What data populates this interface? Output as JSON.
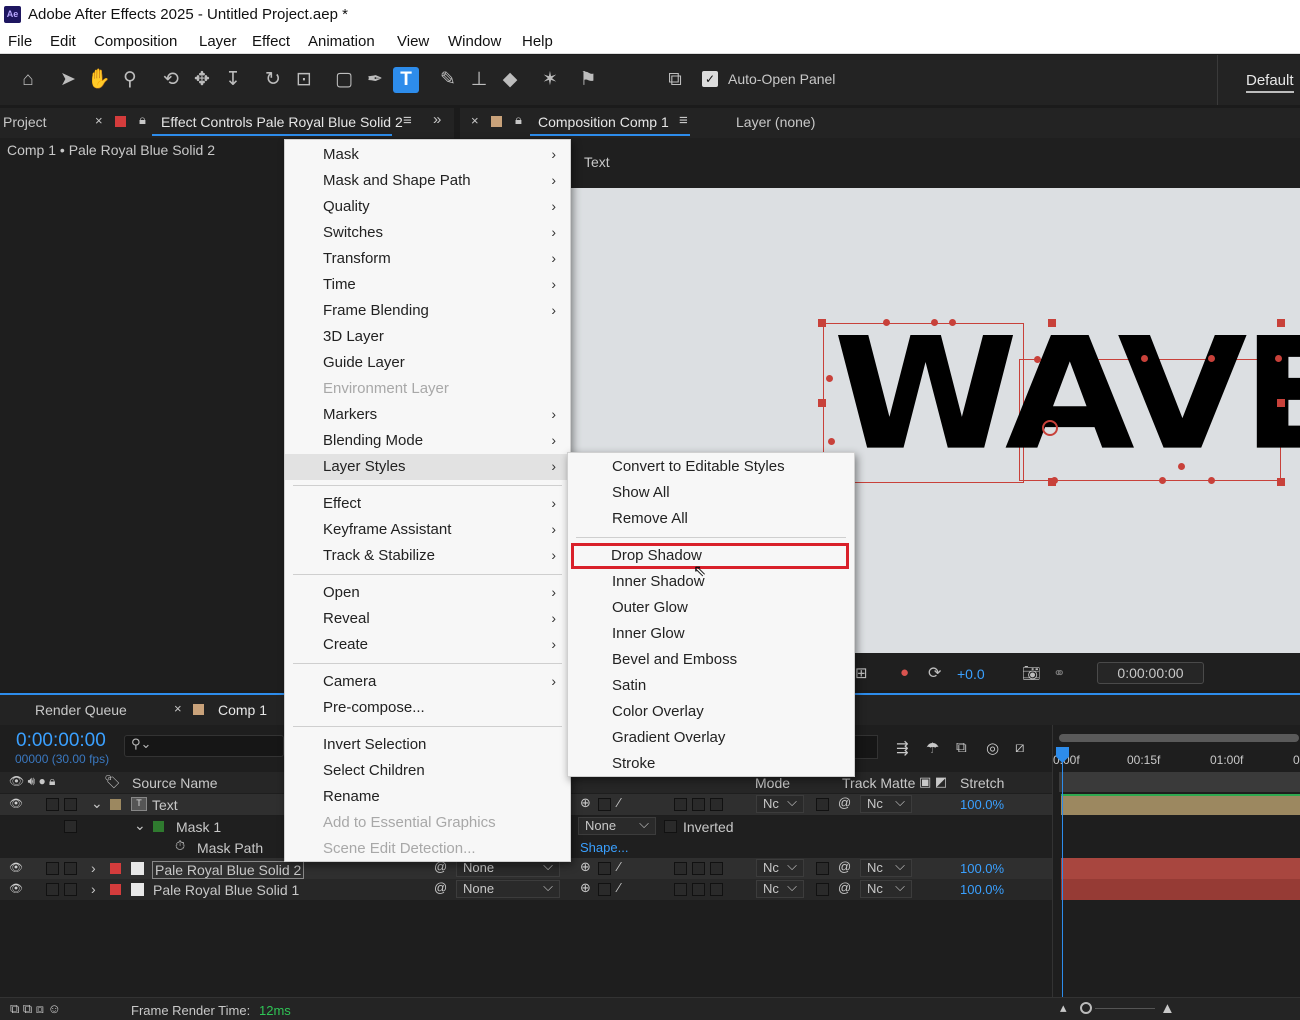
{
  "app": {
    "icon_text": "Ae",
    "title": "Adobe After Effects 2025 - Untitled Project.aep *"
  },
  "menubar": [
    "File",
    "Edit",
    "Composition",
    "Layer",
    "Effect",
    "Animation",
    "View",
    "Window",
    "Help"
  ],
  "toolbar": {
    "auto_open_label": "Auto-Open Panel",
    "auto_open_checked": true,
    "workspace": "Default",
    "tools": [
      "home-icon",
      "selection-tool-icon",
      "hand-tool-icon",
      "zoom-tool-icon",
      "orbit-camera-icon",
      "pan-camera-icon",
      "dolly-camera-icon",
      "rotation-tool-icon",
      "pan-behind-icon",
      "rectangle-tool-icon",
      "pen-tool-icon",
      "type-tool-icon",
      "brush-tool-icon",
      "clone-stamp-icon",
      "eraser-icon",
      "roto-brush-icon",
      "puppet-pin-icon",
      "snapping-icon"
    ]
  },
  "left_panel": {
    "tab_project": "Project",
    "tab_effect_controls": "Effect Controls Pale Royal Blue Solid 2",
    "breadcrumb": "Comp 1 • Pale Royal Blue Solid 2"
  },
  "comp_panel": {
    "tab_label": "Composition Comp 1",
    "layer_tab": "Layer (none)",
    "sub_label": "Text",
    "canvas_text": "WAVE",
    "exposure": "+0.0",
    "timecode": "0:00:00:00"
  },
  "timeline": {
    "tab_render": "Render Queue",
    "tab_comp": "Comp 1",
    "timecode": "0:00:00:00",
    "frame_info": "00000 (30.00 fps)",
    "search_placeholder": "",
    "col_source": "Source Name",
    "col_mode": "Mode",
    "col_trackmatte": "Track Matte",
    "col_stretch": "Stretch",
    "ruler": [
      "0:00f",
      "00:15f",
      "01:00f",
      "0"
    ],
    "layers": [
      {
        "name": "Text",
        "mode": "Nc",
        "matte": "Nc",
        "stretch": "100.0%"
      },
      {
        "name": "Mask 1",
        "mask_mode": "None",
        "inverted": "Inverted"
      },
      {
        "name": "Mask Path",
        "value": "Shape..."
      },
      {
        "name": "Pale Royal Blue Solid 2",
        "parent": "None",
        "mode": "Nc",
        "matte": "Nc",
        "stretch": "100.0%"
      },
      {
        "name": "Pale Royal Blue Solid 1",
        "parent": "None",
        "mode": "Nc",
        "matte": "Nc",
        "stretch": "100.0%"
      }
    ],
    "footer_label": "Frame Render Time:",
    "footer_value": "12ms"
  },
  "context_menu": {
    "items": [
      {
        "label": "Mask",
        "submenu": true
      },
      {
        "label": "Mask and Shape Path",
        "submenu": true
      },
      {
        "label": "Quality",
        "submenu": true
      },
      {
        "label": "Switches",
        "submenu": true
      },
      {
        "label": "Transform",
        "submenu": true
      },
      {
        "label": "Time",
        "submenu": true
      },
      {
        "label": "Frame Blending",
        "submenu": true
      },
      {
        "label": "3D Layer",
        "submenu": false
      },
      {
        "label": "Guide Layer",
        "submenu": false
      },
      {
        "label": "Environment Layer",
        "submenu": false,
        "disabled": true
      },
      {
        "label": "Markers",
        "submenu": true
      },
      {
        "label": "Blending Mode",
        "submenu": true
      },
      {
        "label": "Layer Styles",
        "submenu": true,
        "highlighted": true
      },
      {
        "label": "Effect",
        "submenu": true
      },
      {
        "label": "Keyframe Assistant",
        "submenu": true
      },
      {
        "label": "Track & Stabilize",
        "submenu": true
      },
      {
        "label": "Open",
        "submenu": true
      },
      {
        "label": "Reveal",
        "submenu": true
      },
      {
        "label": "Create",
        "submenu": true
      },
      {
        "label": "Camera",
        "submenu": true
      },
      {
        "label": "Pre-compose...",
        "submenu": false
      },
      {
        "label": "Invert Selection",
        "submenu": false
      },
      {
        "label": "Select Children",
        "submenu": false
      },
      {
        "label": "Rename",
        "submenu": false
      },
      {
        "label": "Add to Essential Graphics",
        "submenu": false,
        "disabled": true
      },
      {
        "label": "Scene Edit Detection...",
        "submenu": false,
        "disabled": true
      }
    ]
  },
  "submenu": {
    "items": [
      "Convert to Editable Styles",
      "Show All",
      "Remove All",
      "Drop Shadow",
      "Inner Shadow",
      "Outer Glow",
      "Inner Glow",
      "Bevel and Emboss",
      "Satin",
      "Color Overlay",
      "Gradient Overlay",
      "Stroke"
    ],
    "highlighted": "Drop Shadow",
    "highlight_color": "#d9202a"
  },
  "colors": {
    "accent_blue": "#2d8ceb",
    "layer_red": "#c8413a",
    "mask_green": "#2f7a2f",
    "text_layer_tan": "#9c8860"
  }
}
